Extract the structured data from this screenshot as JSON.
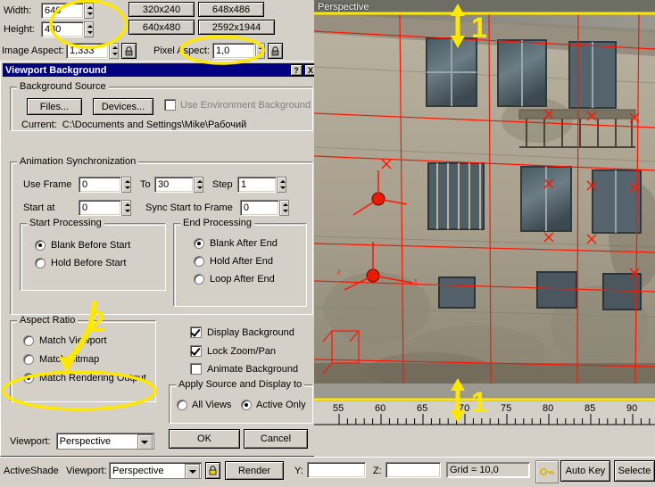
{
  "render_setup": {
    "width_label": "Width:",
    "width_value": "640",
    "height_label": "Height:",
    "height_value": "480",
    "presets": [
      "320x240",
      "648x486",
      "640x480",
      "2592x1944"
    ],
    "image_aspect_label": "Image Aspect:",
    "image_aspect_value": "1,333",
    "pixel_aspect_label": "Pixel Aspect:",
    "pixel_aspect_value": "1,0",
    "lock_icon": "lock-icon"
  },
  "dialog": {
    "title": "Viewport Background",
    "help_btn": "?",
    "close_btn": "X",
    "background_source": {
      "legend": "Background Source",
      "files_btn": "Files...",
      "devices_btn": "Devices...",
      "use_env_label": "Use Environment Background",
      "use_env_checked": false,
      "current_label": "Current:",
      "current_value": "C:\\Documents and Settings\\Mike\\Рабочий"
    },
    "animation_sync": {
      "legend": "Animation Synchronization",
      "use_frame_label": "Use Frame",
      "use_frame_value": "0",
      "to_label": "To",
      "to_value": "30",
      "step_label": "Step",
      "step_value": "1",
      "start_at_label": "Start at",
      "start_at_value": "0",
      "sync_start_label": "Sync Start to Frame",
      "sync_start_value": "0",
      "start_processing": {
        "legend": "Start Processing",
        "options": [
          "Blank Before Start",
          "Hold Before Start"
        ],
        "selected": 0
      },
      "end_processing": {
        "legend": "End Processing",
        "options": [
          "Blank After End",
          "Hold After End",
          "Loop After End"
        ],
        "selected": 0
      }
    },
    "aspect_ratio": {
      "legend": "Aspect Ratio",
      "options": [
        "Match Viewport",
        "Match Bitmap",
        "Match Rendering Output"
      ],
      "selected": 2
    },
    "display_options": [
      {
        "label": "Display Background",
        "checked": true
      },
      {
        "label": "Lock Zoom/Pan",
        "checked": true
      },
      {
        "label": "Animate Background",
        "checked": false
      }
    ],
    "apply_source": {
      "legend": "Apply Source and Display to",
      "options": [
        "All Views",
        "Active Only"
      ],
      "selected": 1
    },
    "viewport_label": "Viewport:",
    "viewport_value": "Perspective",
    "ok_btn": "OK",
    "cancel_btn": "Cancel"
  },
  "viewport": {
    "label": "Perspective",
    "ruler_ticks": [
      "55",
      "60",
      "65",
      "70",
      "75",
      "80",
      "85",
      "90"
    ]
  },
  "statusbar": {
    "active_shade": "ActiveShade",
    "viewport_label": "Viewport:",
    "viewport_value": "Perspective",
    "lock_icon": "lock-icon",
    "render_btn": "Render",
    "y_label": "Y:",
    "y_value": "",
    "z_label": "Z:",
    "z_value": "",
    "grid_label": "Grid = 10,0",
    "key_icon": "key-icon",
    "auto_key": "Auto Key",
    "selected": "Selecte"
  },
  "annotations": {
    "markers": [
      {
        "id": "marker-1-top",
        "text": "1"
      },
      {
        "id": "marker-1-bottom",
        "text": "1"
      },
      {
        "id": "marker-2-arrow",
        "text": "2"
      }
    ],
    "highlight_color": "#ffe800"
  }
}
